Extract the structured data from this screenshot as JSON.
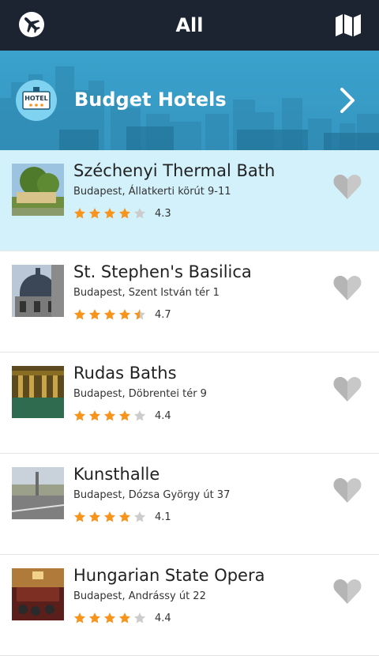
{
  "header": {
    "title": "All",
    "left_icon": "airplane-icon",
    "right_icon": "map-icon"
  },
  "banner": {
    "title": "Budget Hotels",
    "badge_text": "HOTEL",
    "accent": "#3aa2cc"
  },
  "colors": {
    "selected_row": "#d3f1fb",
    "star_on": "#f7941d",
    "star_off": "#cccccc",
    "heart": "#c8c8c8"
  },
  "items": [
    {
      "name": "Széchenyi Thermal Bath",
      "address": "Budapest, Állatkerti körút 9-11",
      "rating": "4.3",
      "stars": [
        1,
        1,
        1,
        1,
        0
      ]
    },
    {
      "name": "St. Stephen's Basilica",
      "address": "Budapest, Szent István tér 1",
      "rating": "4.7",
      "stars": [
        1,
        1,
        1,
        1,
        0.5
      ]
    },
    {
      "name": "Rudas Baths",
      "address": "Budapest, Döbrentei tér 9",
      "rating": "4.4",
      "stars": [
        1,
        1,
        1,
        1,
        0
      ]
    },
    {
      "name": "Kunsthalle",
      "address": "Budapest, Dózsa György út 37",
      "rating": "4.1",
      "stars": [
        1,
        1,
        1,
        1,
        0
      ]
    },
    {
      "name": "Hungarian State Opera",
      "address": "Budapest, Andrássy út 22",
      "rating": "4.4",
      "stars": [
        1,
        1,
        1,
        1,
        0
      ]
    }
  ]
}
